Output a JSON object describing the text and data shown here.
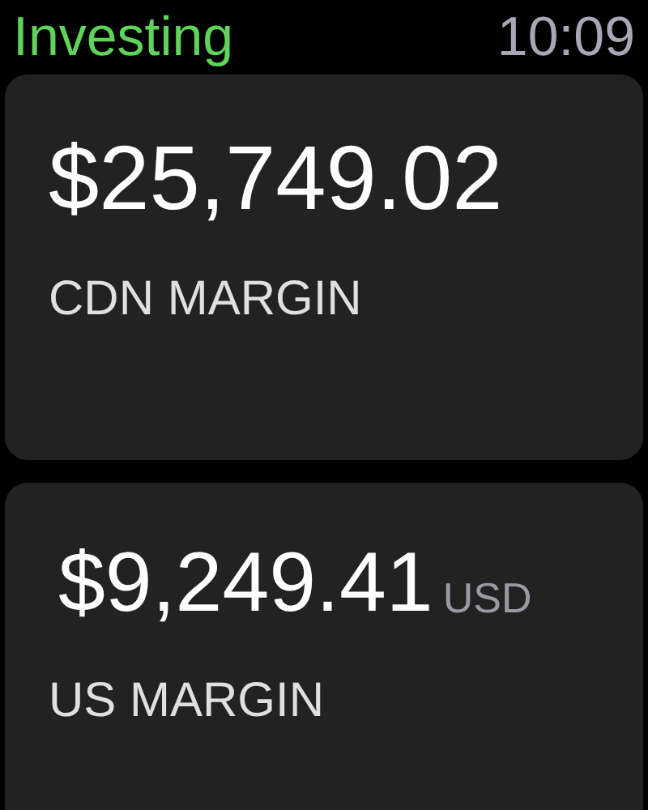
{
  "header": {
    "title": "Investing",
    "time": "10:09"
  },
  "accounts": [
    {
      "amount": "$25,749.02",
      "label": "CDN MARGIN"
    },
    {
      "amount": "$9,249.41",
      "currency": "USD",
      "label": "US MARGIN"
    }
  ]
}
